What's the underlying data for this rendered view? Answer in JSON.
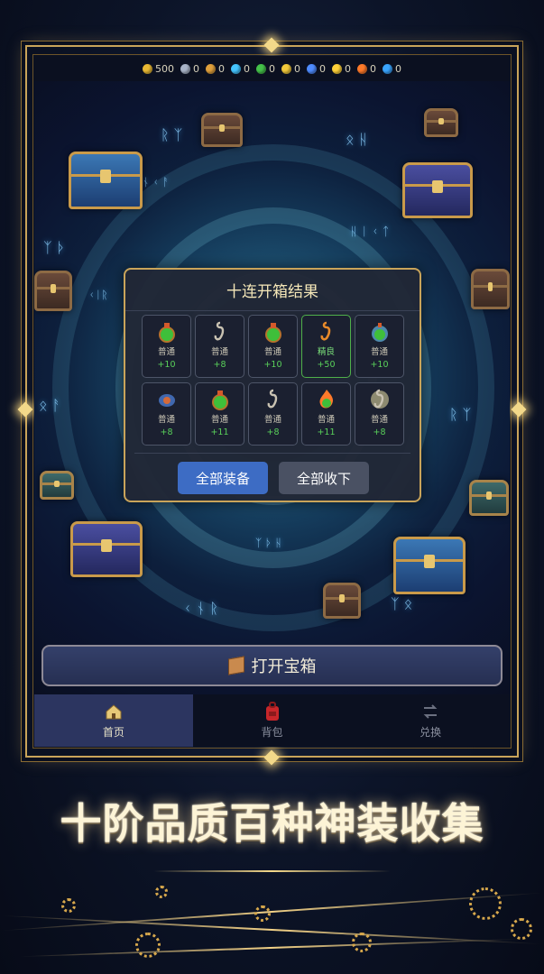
{
  "resources": [
    {
      "name": "gold",
      "value": "500",
      "color": "#e9b934"
    },
    {
      "name": "silver-medal",
      "value": "0",
      "color": "#a9b4c8"
    },
    {
      "name": "gold-medal",
      "value": "0",
      "color": "#e0a03c"
    },
    {
      "name": "diamond",
      "value": "0",
      "color": "#45c5ff"
    },
    {
      "name": "green-orb",
      "value": "0",
      "color": "#45c24a"
    },
    {
      "name": "star",
      "value": "0",
      "color": "#f2c93b"
    },
    {
      "name": "vortex",
      "value": "0",
      "color": "#4f8cff"
    },
    {
      "name": "sun",
      "value": "0",
      "color": "#ffd23a"
    },
    {
      "name": "flame",
      "value": "0",
      "color": "#ff7a2a"
    },
    {
      "name": "water",
      "value": "0",
      "color": "#3aa5ff"
    }
  ],
  "result_panel": {
    "title": "十连开箱结果",
    "items": [
      {
        "icon": "green-potion-icon",
        "quality": "普通",
        "value": "+10",
        "highlight": false
      },
      {
        "icon": "hook-icon",
        "quality": "普通",
        "value": "+8",
        "highlight": false
      },
      {
        "icon": "green-potion-icon",
        "quality": "普通",
        "value": "+10",
        "highlight": false
      },
      {
        "icon": "golden-hook-icon",
        "quality": "精良",
        "value": "+50",
        "highlight": true
      },
      {
        "icon": "frost-potion-icon",
        "quality": "普通",
        "value": "+10",
        "highlight": false
      },
      {
        "icon": "crystal-amulet-icon",
        "quality": "普通",
        "value": "+8",
        "highlight": false
      },
      {
        "icon": "green-potion-icon",
        "quality": "普通",
        "value": "+11",
        "highlight": false
      },
      {
        "icon": "hook-icon",
        "quality": "普通",
        "value": "+8",
        "highlight": false
      },
      {
        "icon": "fire-potion-icon",
        "quality": "普通",
        "value": "+11",
        "highlight": false
      },
      {
        "icon": "shining-hook-icon",
        "quality": "普通",
        "value": "+8",
        "highlight": false
      }
    ],
    "equip_all_label": "全部装备",
    "collect_all_label": "全部收下"
  },
  "open_chest_label": "打开宝箱",
  "nav": [
    {
      "label": "首页",
      "icon": "house-icon",
      "active": true
    },
    {
      "label": "背包",
      "icon": "backpack-icon",
      "active": false
    },
    {
      "label": "兑换",
      "icon": "exchange-icon",
      "active": false
    }
  ],
  "slogan": "十阶品质百种神装收集"
}
